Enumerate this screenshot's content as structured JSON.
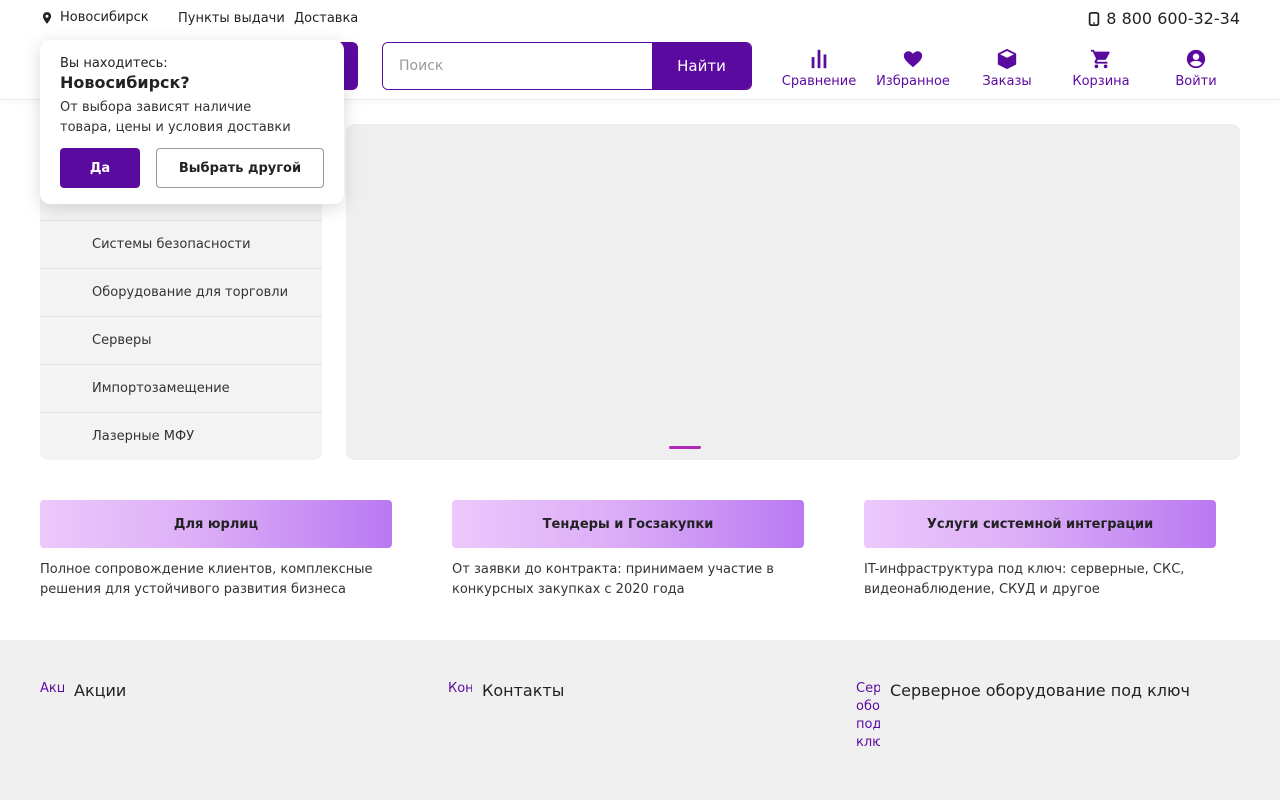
{
  "topbar": {
    "city": "Новосибирск",
    "links": [
      "Пункты выдачи",
      "Доставка"
    ],
    "phone": "8 800 600-32-34"
  },
  "search": {
    "placeholder": "Поиск",
    "button": "Найти"
  },
  "nav": [
    {
      "label": "Сравнение",
      "icon": "chart-icon"
    },
    {
      "label": "Избранное",
      "icon": "heart-icon"
    },
    {
      "label": "Заказы",
      "icon": "box-icon"
    },
    {
      "label": "Корзина",
      "icon": "cart-icon"
    },
    {
      "label": "Войти",
      "icon": "user-icon"
    }
  ],
  "popup": {
    "question": "Вы находитесь:",
    "city": "Новосибирск?",
    "description": "От выбора зависят наличие товара, цены и условия доставки",
    "yes": "Да",
    "other": "Выбрать другой"
  },
  "menu": [
    "Системы безопасности",
    "Оборудование для торговли",
    "Серверы",
    "Импортозамещение",
    "Лазерные МФУ"
  ],
  "cards": [
    {
      "title": "Для юрлиц",
      "text": "Полное сопровождение клиентов, комплексные решения для устойчивого развития бизнеса"
    },
    {
      "title": "Тендеры и Госзакупки",
      "text": "От заявки до контракта: принимаем участие в конкурсных закупках с 2020 года"
    },
    {
      "title": "Услуги системной интеграции",
      "text": "IT-инфраструктура под ключ: серверные, СКС, видеонаблюдение, СКУД и другое"
    }
  ],
  "bottom": [
    {
      "alt": "Акц",
      "label": "Акции"
    },
    {
      "alt": "Кон",
      "label": "Контакты"
    },
    {
      "alt": "Сер обо под клю",
      "label": "Серверное оборудование под ключ"
    }
  ],
  "colors": {
    "accent": "#5b0aa0",
    "dot": "#b02ab8"
  }
}
